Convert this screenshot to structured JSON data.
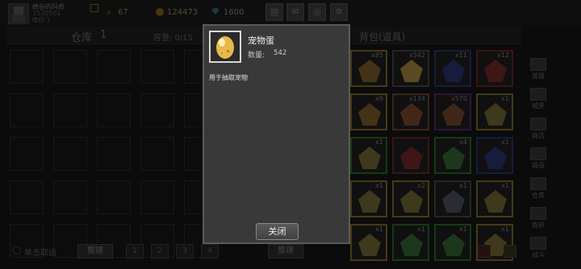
{
  "player": {
    "name": "绝谷的玛奇",
    "id": "2530561",
    "vip": "暗月门"
  },
  "resources": {
    "energy": "67",
    "gold": "124473",
    "gems": "1600"
  },
  "top_icons": [
    "shop-icon",
    "mail-icon",
    "gamepad-icon",
    "settings-icon"
  ],
  "warehouse": {
    "title": "仓库",
    "number": "1",
    "capacity": "容量: 0/15"
  },
  "bag": {
    "title": "背包(道具)"
  },
  "bag_counts": [
    "x85",
    "x542",
    "x11",
    "x12",
    "x9",
    "x134",
    "x570",
    "x1",
    "x1",
    "",
    "x4",
    "x1",
    "x1",
    "x2",
    "x1",
    "x1",
    "x1",
    "x1",
    "x1",
    "x1"
  ],
  "right_nav": [
    "英雄",
    "城堡",
    "商店",
    "锻造",
    "仓库",
    "炼妖",
    "战斗"
  ],
  "bottom": {
    "single_take": "单击取出",
    "sort_left": "整理",
    "pages": [
      "1",
      "2",
      "3",
      "4"
    ],
    "sort_right": "整理"
  },
  "popup": {
    "item_name": "宠物蛋",
    "qty_label": "数量:",
    "qty": "542",
    "description": "用于抽取宠物",
    "close_label": "关闭"
  },
  "colors": {
    "popup_bg": "#393939",
    "egg": "#e8b84a",
    "grid_green": "#1f5a1f",
    "grid_purple": "#4a1f5a",
    "grid_blue": "#1f2f5a",
    "grid_gold": "#6a5a1f"
  }
}
